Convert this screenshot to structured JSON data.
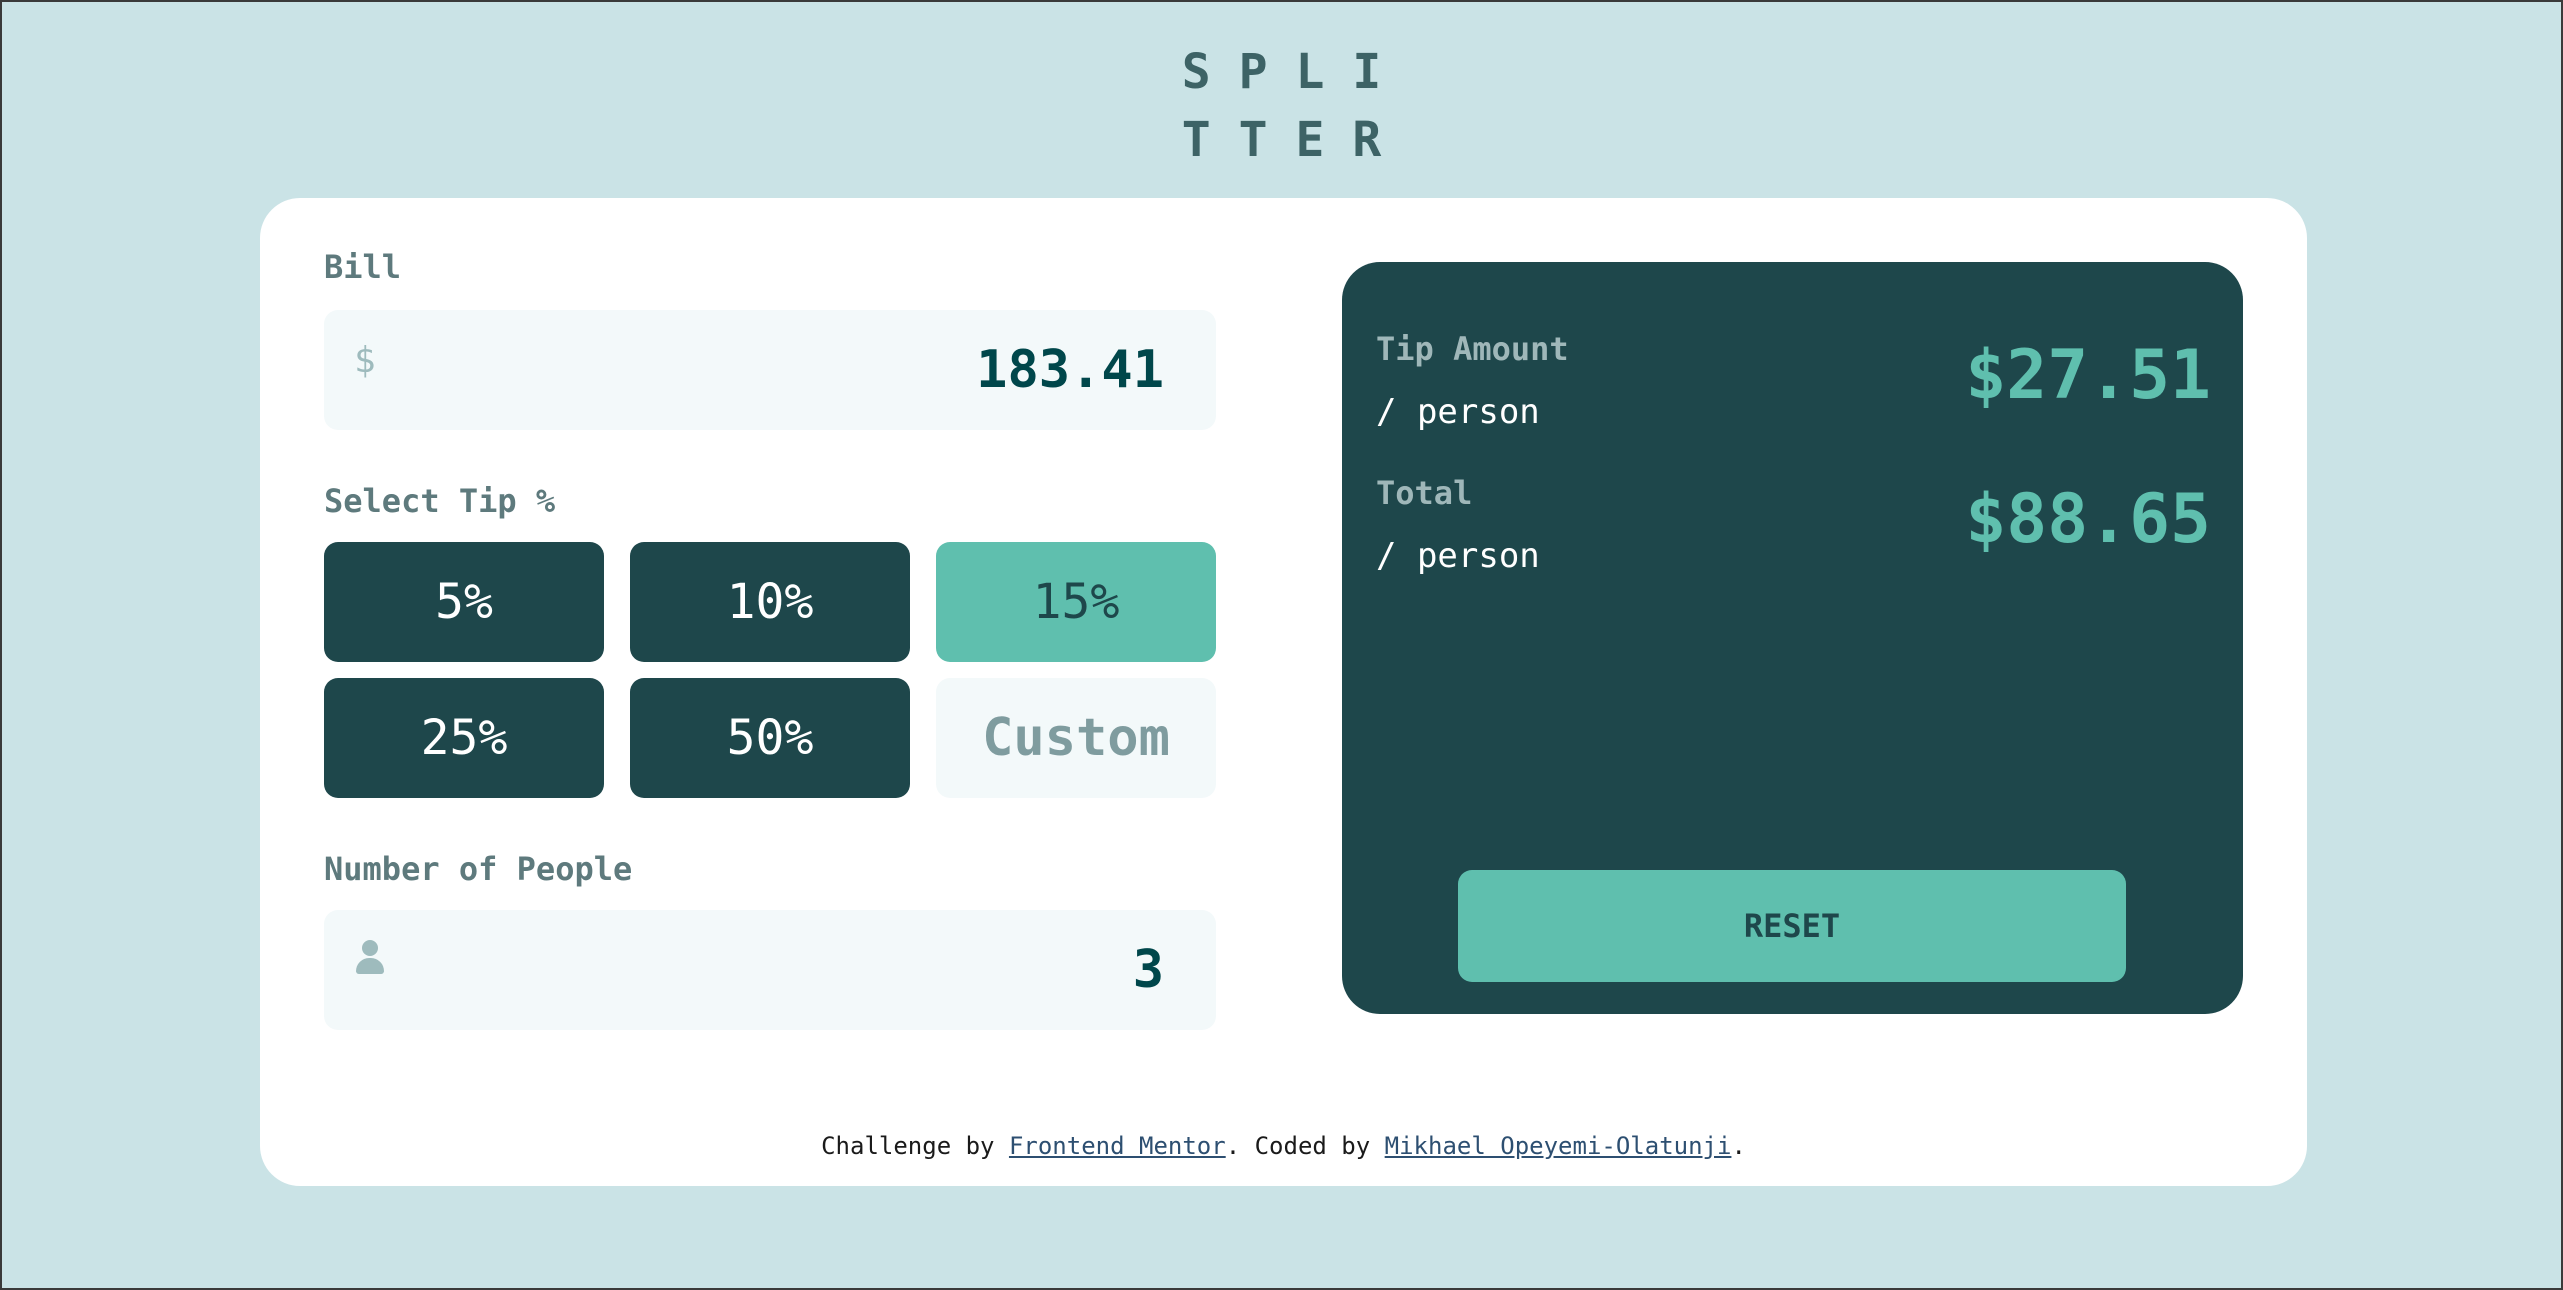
{
  "app": {
    "logo_line1": "SPLI",
    "logo_line2": "TTER"
  },
  "bill": {
    "label": "Bill",
    "currency_symbol": "$",
    "value": "183.41"
  },
  "tip": {
    "label": "Select Tip %",
    "options": [
      "5%",
      "10%",
      "15%",
      "25%",
      "50%"
    ],
    "selected": "15%",
    "custom_placeholder": "Custom"
  },
  "people": {
    "label": "Number of People",
    "value": "3",
    "icon": "person-icon"
  },
  "results": {
    "tip_amount_label": "Tip Amount",
    "tip_amount_sub": "/ person",
    "tip_amount_value": "$27.51",
    "total_label": "Total",
    "total_sub": "/ person",
    "total_value": "$88.65",
    "reset_label": "RESET"
  },
  "footer": {
    "prefix": "Challenge by ",
    "link1": "Frontend Mentor",
    "middle": ". Coded by ",
    "link2": "Mikhael Opeyemi-Olatunji",
    "suffix": "."
  },
  "colors": {
    "background": "#cae3e6",
    "dark_teal": "#1e474b",
    "accent": "#5fbfae",
    "card": "#ffffff",
    "input_bg": "#f3f9fa"
  }
}
